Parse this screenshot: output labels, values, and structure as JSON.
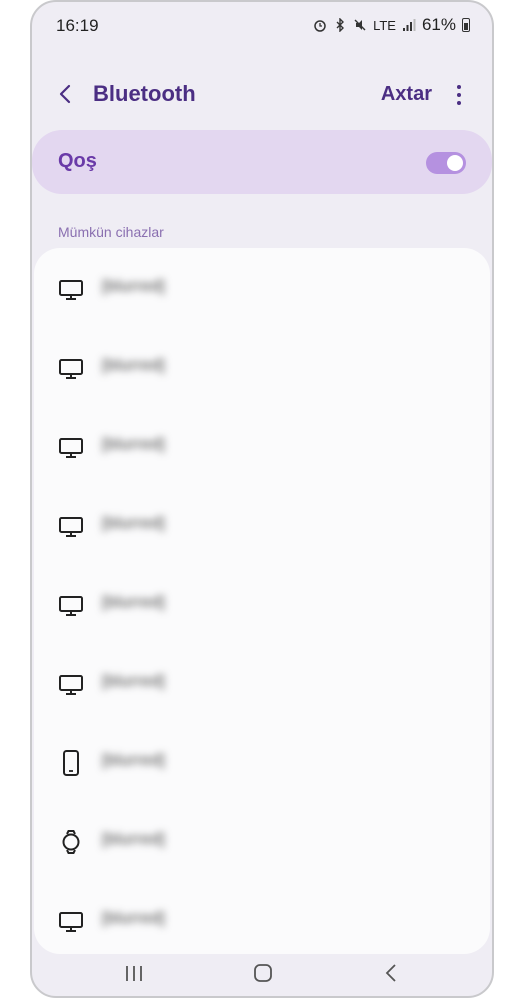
{
  "status": {
    "time": "16:19",
    "battery": "61%",
    "network": "LTE"
  },
  "header": {
    "title": "Bluetooth",
    "search_label": "Axtar"
  },
  "toggle": {
    "label": "Qoş",
    "enabled": true
  },
  "section": {
    "available_label": "Mümkün cihazlar"
  },
  "devices": [
    {
      "name": "[blurred]",
      "icon": "tv-icon"
    },
    {
      "name": "[blurred]",
      "icon": "tv-icon"
    },
    {
      "name": "[blurred]",
      "icon": "tv-icon"
    },
    {
      "name": "[blurred]",
      "icon": "tv-icon"
    },
    {
      "name": "[blurred]",
      "icon": "tv-icon"
    },
    {
      "name": "[blurred]",
      "icon": "tv-icon"
    },
    {
      "name": "[blurred]",
      "icon": "phone-icon"
    },
    {
      "name": "[blurred]",
      "icon": "watch-icon"
    },
    {
      "name": "[blurred]",
      "icon": "tv-icon"
    }
  ],
  "colors": {
    "accent": "#4b2e83",
    "toggle_bg": "#e3d7f0",
    "switch": "#b591e0"
  }
}
